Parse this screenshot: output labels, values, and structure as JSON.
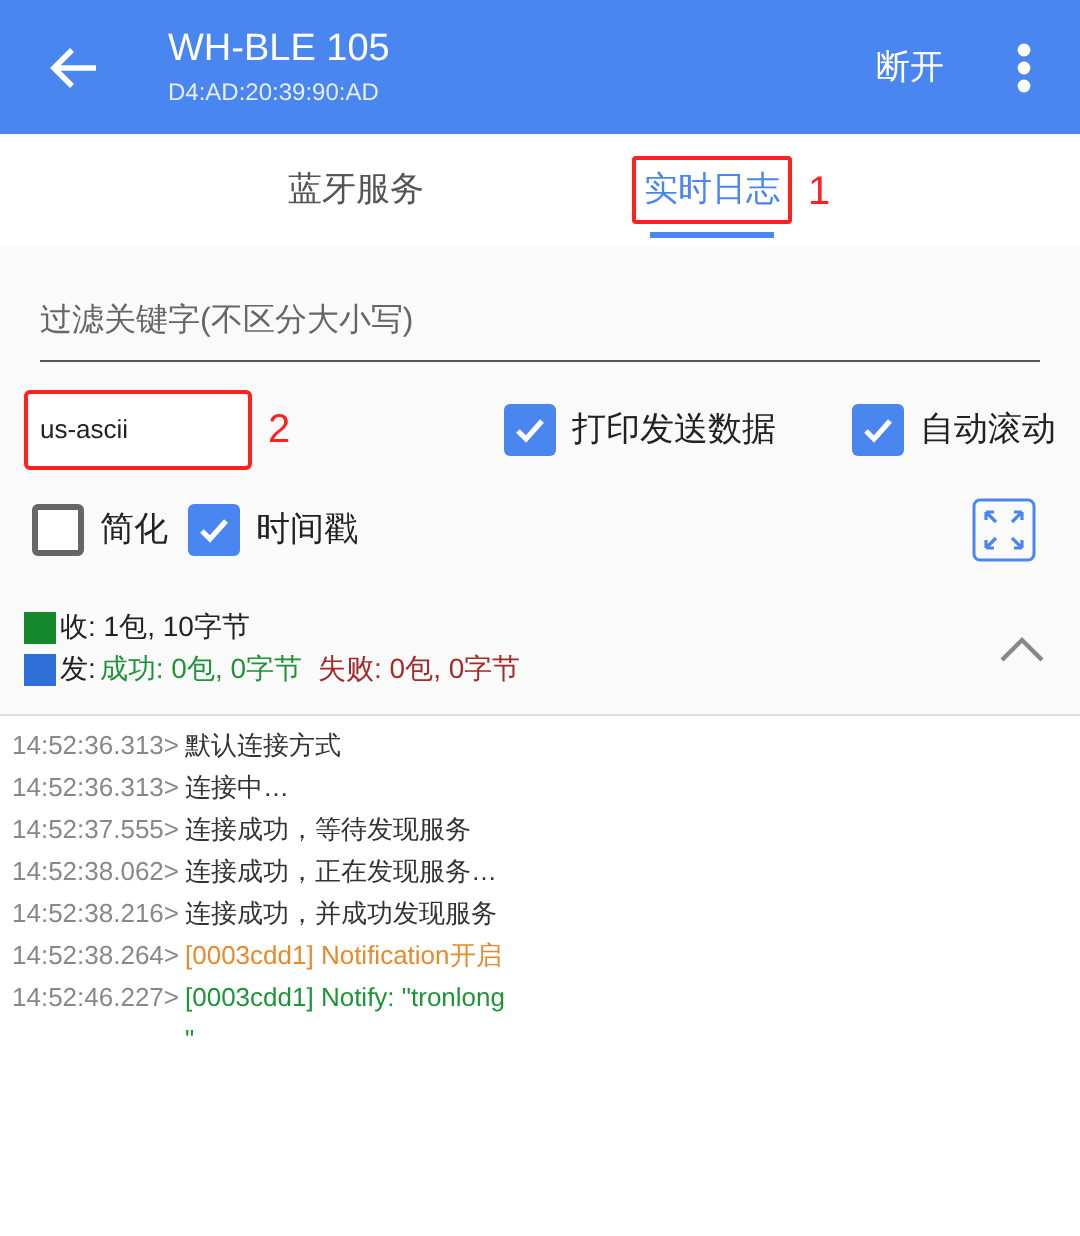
{
  "header": {
    "title": "WH-BLE 105",
    "subtitle": "D4:AD:20:39:90:AD",
    "action": "断开"
  },
  "tabs": [
    {
      "label": "蓝牙服务",
      "selected": false
    },
    {
      "label": "实时日志",
      "selected": true,
      "annotation": "1"
    }
  ],
  "filter": {
    "placeholder": "过滤关键字(不区分大小写)"
  },
  "encoding": {
    "value": "us-ascii",
    "annotation": "2"
  },
  "options_row1": [
    {
      "label": "打印发送数据",
      "checked": true
    },
    {
      "label": "自动滚动",
      "checked": true
    }
  ],
  "options_row2": [
    {
      "label": "简化",
      "checked": false
    },
    {
      "label": "时间戳",
      "checked": true
    }
  ],
  "stats": {
    "received": {
      "color": "#14892c",
      "text": "收: 1包, 10字节"
    },
    "sent": {
      "color": "#2f6fd8",
      "label": "发:",
      "success": "成功: 0包, 0字节",
      "failure": "失败: 0包, 0字节"
    }
  },
  "log": [
    {
      "time": "14:52:36.313>",
      "text": "默认连接方式",
      "kind": "info"
    },
    {
      "time": "14:52:36.313>",
      "text": "连接中…",
      "kind": "info"
    },
    {
      "time": "14:52:37.555>",
      "text": "连接成功，等待发现服务",
      "kind": "info"
    },
    {
      "time": "14:52:38.062>",
      "text": "连接成功，正在发现服务…",
      "kind": "info"
    },
    {
      "time": "14:52:38.216>",
      "text": "连接成功，并成功发现服务",
      "kind": "info"
    },
    {
      "time": "14:52:38.264>",
      "text": "[0003cdd1] Notification开启",
      "kind": "notice"
    },
    {
      "time": "14:52:46.227>",
      "text": "[0003cdd1] Notify: \"tronlong\n\"",
      "kind": "data"
    }
  ]
}
